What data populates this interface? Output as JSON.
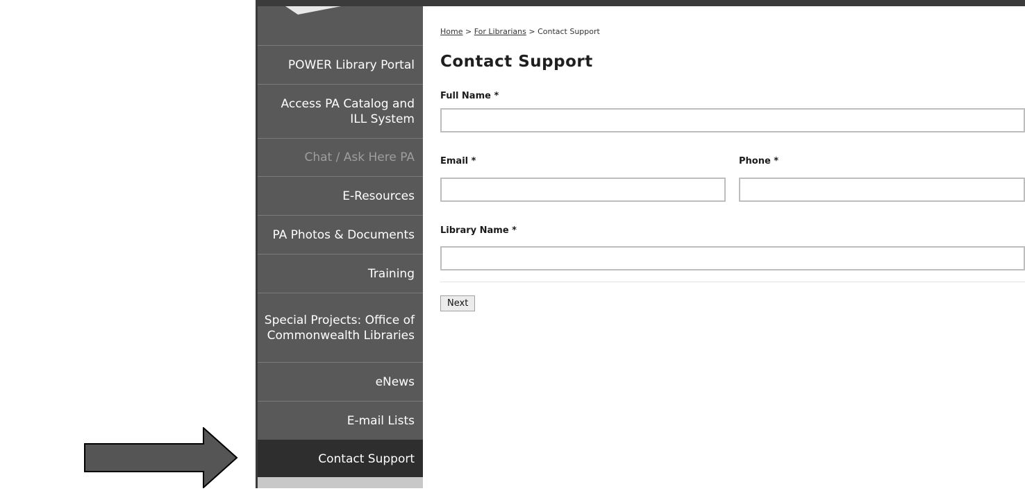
{
  "breadcrumb": {
    "home": "Home",
    "sep1": " > ",
    "for_librarians": "For Librarians",
    "sep2": " > ",
    "current": "Contact Support"
  },
  "page_title": "Contact Support",
  "sidebar": {
    "items": [
      {
        "label": "POWER Library Portal"
      },
      {
        "label": "Access PA Catalog and ILL System"
      },
      {
        "label": "Chat / Ask Here PA"
      },
      {
        "label": "E-Resources"
      },
      {
        "label": "PA Photos & Documents"
      },
      {
        "label": "Training"
      },
      {
        "label": "Special Projects: Office of Commonwealth Libraries"
      },
      {
        "label": "eNews"
      },
      {
        "label": "E-mail Lists"
      },
      {
        "label": "Contact Support"
      }
    ]
  },
  "form": {
    "full_name_label": "Full Name *",
    "full_name_value": "",
    "email_label": "Email *",
    "email_value": "",
    "phone_label": "Phone *",
    "phone_value": "",
    "library_name_label": "Library Name *",
    "library_name_value": "",
    "next_label": "Next"
  },
  "colors": {
    "sidebar_bg": "#595959",
    "sidebar_active": "#2e2e2e",
    "topbar": "#3b3b3b"
  }
}
